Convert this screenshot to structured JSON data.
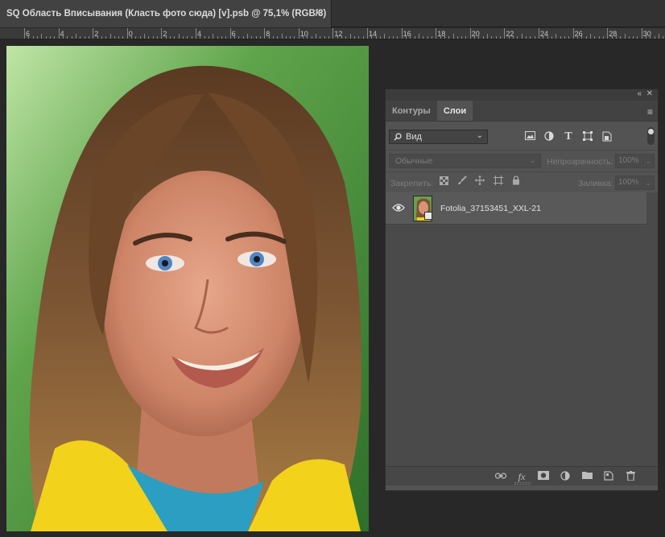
{
  "document": {
    "tab_title": "SQ Область Вписывания (Класть фото сюда) [v].psb @ 75,1% (RGB/8)",
    "close_glyph": "✕"
  },
  "ruler": {
    "labels": [
      "6",
      "4",
      "2",
      "0",
      "2",
      "4",
      "6",
      "8",
      "10",
      "12",
      "14",
      "16",
      "18",
      "20",
      "22",
      "24",
      "26",
      "28",
      "30"
    ]
  },
  "layers_panel": {
    "collapse_glyph": "«",
    "close_glyph": "✕",
    "tabs": [
      {
        "label": "Контуры",
        "active": false
      },
      {
        "label": "Слои",
        "active": true
      }
    ],
    "menu_glyph": "≡",
    "filter": {
      "value": "Вид",
      "icons": [
        "image-filter-icon",
        "adjustment-filter-icon",
        "type-filter-icon",
        "shape-filter-icon",
        "smart-object-filter-icon"
      ]
    },
    "blend_mode": "Обычные",
    "opacity_label": "Непрозрачность:",
    "opacity_value": "100%",
    "lock_label": "Закрепить:",
    "lock_icons": [
      "lock-transparent-icon",
      "lock-paint-icon",
      "lock-move-icon",
      "lock-artboard-icon",
      "lock-all-icon"
    ],
    "fill_label": "Заливка:",
    "fill_value": "100%",
    "layers": [
      {
        "name": "Fotolia_37153451_XXL-21",
        "visible": true,
        "smart_object": true
      }
    ],
    "bottom_icons": [
      "link-layers-icon",
      "fx-icon",
      "add-mask-icon",
      "adjustment-layer-icon",
      "new-group-icon",
      "new-layer-icon",
      "delete-layer-icon"
    ]
  }
}
